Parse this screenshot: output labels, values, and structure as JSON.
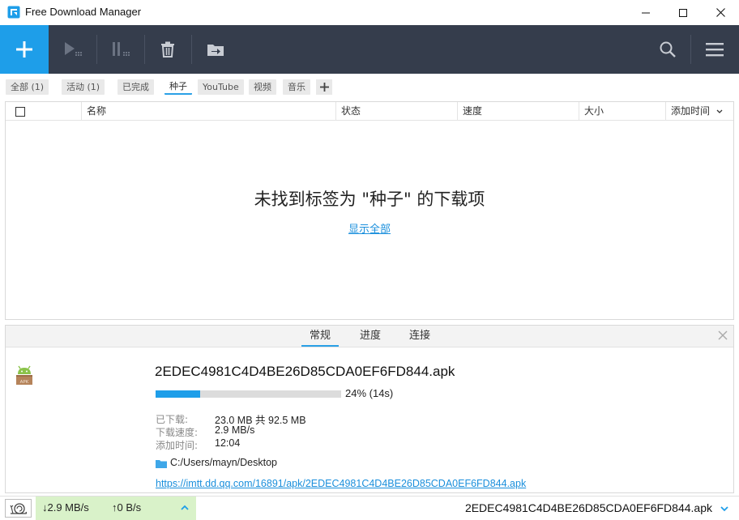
{
  "window": {
    "title": "Free Download Manager"
  },
  "tags": [
    {
      "label": "全部 (1)",
      "active": false
    },
    {
      "label": "活动 (1)",
      "active": false
    },
    {
      "label": "已完成",
      "active": false
    },
    {
      "label": "种子",
      "active": true
    },
    {
      "label": "YouTube",
      "active": false
    },
    {
      "label": "视频",
      "active": false
    },
    {
      "label": "音乐",
      "active": false
    }
  ],
  "table": {
    "columns": {
      "name": "名称",
      "status": "状态",
      "speed": "速度",
      "size": "大小",
      "added": "添加时间"
    },
    "empty_message": "未找到标签为 \"种子\" 的下载项",
    "show_all": "显示全部"
  },
  "details": {
    "tabs": {
      "general": "常规",
      "progress": "进度",
      "connections": "连接"
    },
    "file_icon_label": "APK",
    "file_name": "2EDEC4981C4D4BE26D85CDA0EF6FD844.apk",
    "progress_percent": 24,
    "progress_text": "24% (14s)",
    "downloaded_label": "已下载:",
    "downloaded_value": "23.0 MB 共 92.5 MB",
    "speed_label": "下载速度:",
    "speed_value": "2.9 MB/s",
    "added_label": "添加时间:",
    "added_value": "12:04",
    "folder": "C:/Users/mayn/Desktop",
    "url": "https://imtt.dd.qq.com/16891/apk/2EDEC4981C4D4BE26D85CDA0EF6FD844.apk"
  },
  "statusbar": {
    "download_speed": "↓2.9 MB/s",
    "upload_speed": "↑0 B/s",
    "current_file": "2EDEC4981C4D4BE26D85CDA0EF6FD844.apk"
  },
  "colors": {
    "accent": "#1e9ee9",
    "toolbar_bg": "#353d4c",
    "speed_bg": "#d9f2c9",
    "link": "#1a8fdc"
  }
}
